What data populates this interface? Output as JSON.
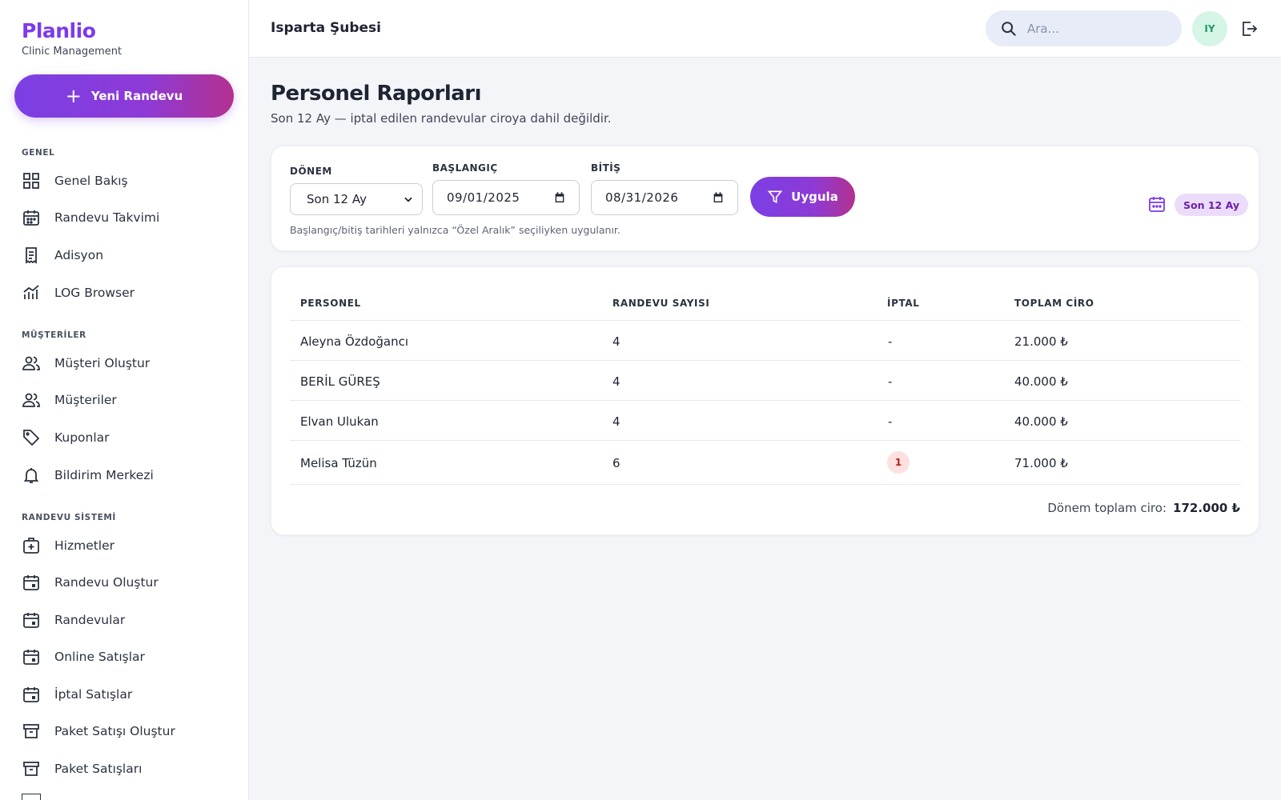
{
  "brand": {
    "name": "Planlio",
    "subtitle": "Clinic Management"
  },
  "sidebar": {
    "new_button": "Yeni Randevu",
    "sections": [
      {
        "title": "GENEL",
        "items": [
          "Genel Bakış",
          "Randevu Takvimi",
          "Adisyon",
          "LOG Browser"
        ]
      },
      {
        "title": "MÜŞTERİLER",
        "items": [
          "Müşteri Oluştur",
          "Müşteriler",
          "Kuponlar",
          "Bildirim Merkezi"
        ]
      },
      {
        "title": "RANDEVU SİSTEMİ",
        "items": [
          "Hizmetler",
          "Randevu Oluştur",
          "Randevular",
          "Online Satışlar",
          "İptal Satışlar",
          "Paket Satışı Oluştur",
          "Paket Satışları"
        ]
      }
    ],
    "icons": {
      "general": [
        "grid-icon",
        "calendar-icon",
        "receipt-icon",
        "chart-icon"
      ],
      "customers": [
        "users-icon",
        "users-icon",
        "tag-icon",
        "bell-icon"
      ],
      "appointments": [
        "medical-kit-icon",
        "calendar-event-icon",
        "calendar-event-icon",
        "calendar-event-icon",
        "calendar-event-icon",
        "archive-icon",
        "archive-icon"
      ]
    }
  },
  "header": {
    "branch": "Isparta Şubesi",
    "search_placeholder": "Ara...",
    "avatar_initials": "IY"
  },
  "main": {
    "title": "Personel Raporları",
    "subtitle": "Son 12 Ay — iptal edilen randevular ciroya dahil değildir."
  },
  "filters": {
    "period_label": "DÖNEM",
    "period_value": "Son 12 Ay",
    "start_label": "BAŞLANGIÇ",
    "start_value": "09/01/2025",
    "end_label": "BİTİŞ",
    "end_value": "08/31/2026",
    "apply_label": "Uygula",
    "hint": "Başlangıç/bitiş tarihleri yalnızca “Özel Aralık” seçiliyken uygulanır.",
    "active_badge": "Son 12 Ay"
  },
  "table": {
    "headers": [
      "PERSONEL",
      "RANDEVU SAYISI",
      "İPTAL",
      "TOPLAM CİRO"
    ],
    "rows": [
      {
        "name": "Aleyna Özdoğancı",
        "count": "4",
        "cancel": "-",
        "revenue": "21.000 ₺"
      },
      {
        "name": "BERİL GÜREŞ",
        "count": "4",
        "cancel": "-",
        "revenue": "40.000 ₺"
      },
      {
        "name": "Elvan Ulukan",
        "count": "4",
        "cancel": "-",
        "revenue": "40.000 ₺"
      },
      {
        "name": "Melisa Tüzün",
        "count": "6",
        "cancel": "1",
        "revenue": "71.000 ₺"
      }
    ],
    "total_label": "Dönem toplam ciro:",
    "total_value": "172.000 ₺"
  },
  "colors": {
    "brand": "#7c3aed",
    "gradient_end": "#b3318f",
    "badge_bg": "#ecdcfb",
    "cancel_badge_bg": "#fde0e0"
  }
}
